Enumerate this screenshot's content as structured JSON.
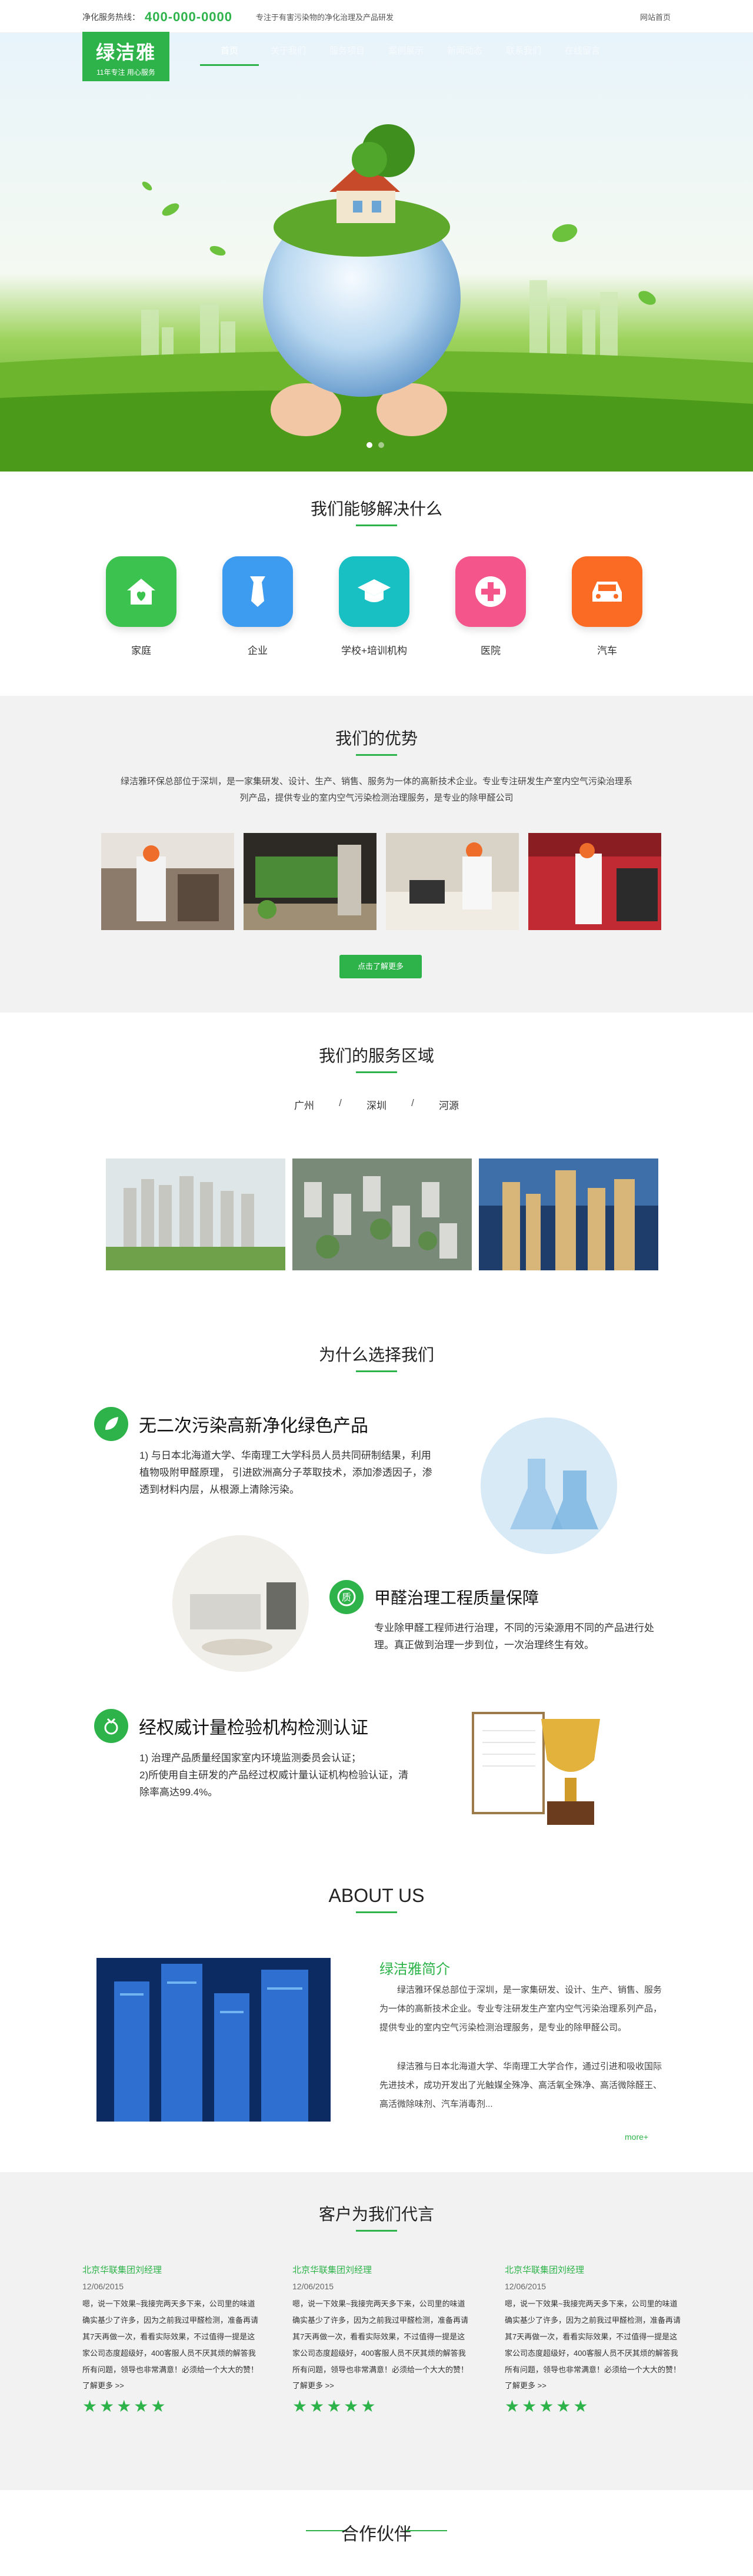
{
  "topbar": {
    "hotline_label": "净化服务热线：",
    "hotline_number": "400-000-0000",
    "tagline": "专注于有害污染物的净化治理及产品研发",
    "home_link": "网站首页"
  },
  "logo": {
    "name": "绿洁雅",
    "slogan": "11年专注  用心服务"
  },
  "nav": {
    "items": [
      "首页",
      "关于我们",
      "服务项目",
      "案例展示",
      "新闻动态",
      "联系我们",
      "在线留言"
    ],
    "active": 0
  },
  "solve": {
    "title": "我们能够解决什么",
    "items": [
      {
        "label": "家庭",
        "icon": "house-heart-icon",
        "color": "#3cc24f"
      },
      {
        "label": "企业",
        "icon": "tie-icon",
        "color": "#3d9bf0"
      },
      {
        "label": "学校+培训机构",
        "icon": "graduation-cap-icon",
        "color": "#18c0c4"
      },
      {
        "label": "医院",
        "icon": "medical-cross-icon",
        "color": "#f4568b"
      },
      {
        "label": "汽车",
        "icon": "car-icon",
        "color": "#fb6b24"
      }
    ]
  },
  "advantages": {
    "title": "我们的优势",
    "description": "绿洁雅环保总部位于深圳，是一家集研发、设计、生产、销售、服务为一体的高新技术企业。专业专注研发生产室内空气污染治理系列产品，提供专业的室内空气污染检测治理服务，是专业的除甲醛公司",
    "button": "点击了解更多"
  },
  "service_area": {
    "title": "我们的服务区域",
    "areas": [
      "广州",
      "深圳",
      "河源"
    ],
    "separator": "/"
  },
  "why": {
    "title": "为什么选择我们",
    "items": [
      {
        "heading": "无二次污染高新净化绿色产品",
        "text": "1) 与日本北海道大学、华南理工大学科员人员共同研制结果，利用植物吸附甲醛原理， 引进欧洲高分子萃取技术，添加渗透因子，渗透到材料内层，从根源上清除污染。",
        "icon": "leaf-icon"
      },
      {
        "heading": "甲醛治理工程质量保障",
        "text": "专业除甲醛工程师进行治理，不同的污染源用不同的产品进行处理。真正做到治理一步到位，一次治理终生有效。",
        "icon": "quality-seal-icon"
      },
      {
        "heading": "经权威计量检验机构检测认证",
        "text": "1) 治理产品质量经国家室内环境监测委员会认证；\n2)所使用自主研发的产品经过权威计量认证机构检验认证，清除率高达99.4%。",
        "icon": "medal-icon"
      }
    ]
  },
  "about": {
    "title": "ABOUT US",
    "subtitle": "绿洁雅简介",
    "paragraphs": [
      "绿洁雅环保总部位于深圳，是一家集研发、设计、生产、销售、服务为一体的高新技术企业。专业专注研发生产室内空气污染治理系列产品，提供专业的室内空气污染检测治理服务，是专业的除甲醛公司。",
      "绿洁雅与日本北海道大学、华南理工大学合作，通过引进和吸收国际先进技术，成功开发出了光触媒全殊净、高活氧全殊净、高活微除醛王、高活微除味剂、汽车消毒剂..."
    ],
    "more": "more+"
  },
  "testimonials": {
    "title": "客户为我们代言",
    "items": [
      {
        "name": "北京华联集团刘经理",
        "date": "12/06/2015",
        "body": "嗯，说一下效果~我接完两天多下来，公司里的味道确实基少了许多，因为之前我过甲醛检测，准备再请其7天再做一次，看看实际效果，不过值得一提是这家公司态度超级好，400客服人员不厌其烦的解答我所有问题，领导也非常满意！必须给一个大大的赞！",
        "more": "了解更多 >>",
        "stars": "★★★★★"
      },
      {
        "name": "北京华联集团刘经理",
        "date": "12/06/2015",
        "body": "嗯，说一下效果~我接完两天多下来，公司里的味道确实基少了许多，因为之前我过甲醛检测，准备再请其7天再做一次，看看实际效果，不过值得一提是这家公司态度超级好，400客服人员不厌其烦的解答我所有问题，领导也非常满意！必须给一个大大的赞！",
        "more": "了解更多 >>",
        "stars": "★★★★★"
      },
      {
        "name": "北京华联集团刘经理",
        "date": "12/06/2015",
        "body": "嗯，说一下效果~我接完两天多下来，公司里的味道确实基少了许多，因为之前我过甲醛检测，准备再请其7天再做一次，看看实际效果，不过值得一提是这家公司态度超级好，400客服人员不厌其烦的解答我所有问题，领导也非常满意！必须给一个大大的赞！",
        "more": "了解更多 >>",
        "stars": "★★★★★"
      }
    ]
  },
  "partners": {
    "title": "合作伙伴"
  },
  "colors": {
    "accent": "#2eb34a",
    "section_bg": "#f2f2f2"
  }
}
